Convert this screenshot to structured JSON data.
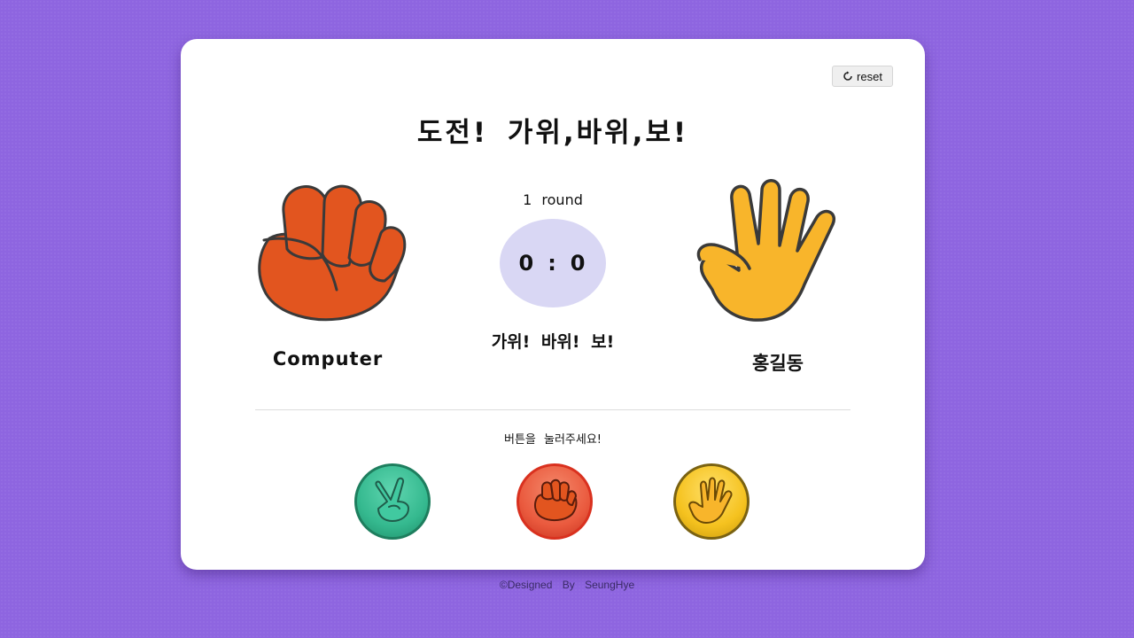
{
  "game": {
    "title": "도전!  가위,바위,보!",
    "reset_label": "reset",
    "round_text": "1  round",
    "score": {
      "computer": "0",
      "separator": ":",
      "user": "0"
    },
    "result_text": "가위! 바위! 보!",
    "computer_label": "Computer",
    "user_label": "홍길동",
    "computer_choice": "rock-icon",
    "user_choice": "paper-icon",
    "instruction": "버튼을 눌러주세요!"
  },
  "buttons": [
    {
      "name": "scissors",
      "icon": "scissors-hand-icon",
      "color": "#35b98f"
    },
    {
      "name": "rock",
      "icon": "rock-hand-icon",
      "color": "#ea5a3e"
    },
    {
      "name": "paper",
      "icon": "paper-hand-icon",
      "color": "#f5c21f"
    }
  ],
  "colors": {
    "background": "#8e65e0",
    "card": "#ffffff",
    "score_bubble": "#d9d7f4",
    "rock": "#e2551f",
    "paper": "#f8b52b"
  },
  "footer": {
    "text": "©Designed By SeungHye"
  }
}
